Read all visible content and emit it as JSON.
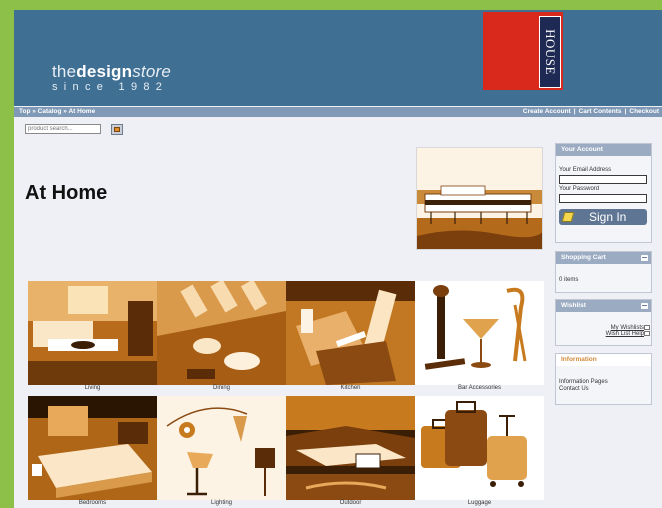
{
  "header": {
    "logo": {
      "part1": "the",
      "part2": "design",
      "part3": "store",
      "tagline": "since 1982"
    },
    "brand_text": "HOUSE"
  },
  "navbar": {
    "breadcrumb": "Top » Catalog » At Home",
    "links": [
      "Create Account",
      "Cart Contents",
      "Checkout"
    ],
    "separator": "|"
  },
  "search": {
    "placeholder": "product search..."
  },
  "main": {
    "title": "At Home",
    "categories": [
      {
        "label": "Living"
      },
      {
        "label": "Dining"
      },
      {
        "label": "Kitchen"
      },
      {
        "label": "Bar Accessories"
      },
      {
        "label": "Bedrooms"
      },
      {
        "label": "Lighting"
      },
      {
        "label": "Outdoor"
      },
      {
        "label": "Luggage"
      }
    ]
  },
  "sidebar": {
    "account": {
      "title": "Your Account",
      "email_label": "Your Email Address",
      "password_label": "Your Password",
      "signin_label": "Sign In"
    },
    "cart": {
      "title": "Shopping Cart",
      "text": "0 items"
    },
    "wishlist": {
      "title": "Wishlist",
      "link1": "My Wishlists",
      "link2": "Wish List Help"
    },
    "information": {
      "title": "Information",
      "link1": "Information Pages",
      "link2": "Contact Us"
    }
  },
  "colors": {
    "header": "#3f6f93",
    "navbar": "#7f99b6",
    "page_bg": "#eef0f6",
    "outer_bg": "#8cc048",
    "accent_red": "#d9291c",
    "accent_navy": "#1f2a54",
    "sepia": "#c87a1e"
  },
  "icons": [
    "search-go-icon",
    "sign-in-icon",
    "collapse-icon"
  ]
}
